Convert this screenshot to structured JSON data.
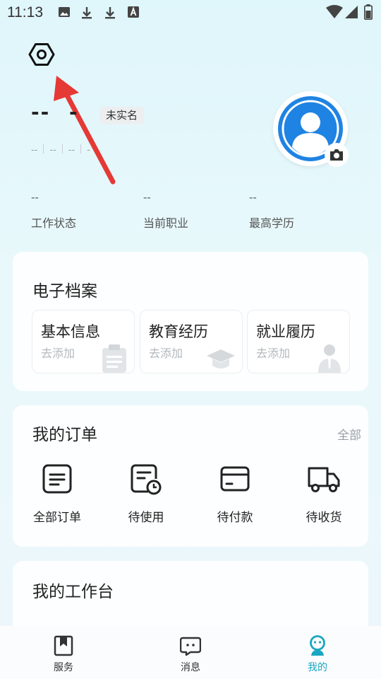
{
  "status_bar": {
    "time": "11:13"
  },
  "profile": {
    "name": "--",
    "name_extra": "-",
    "verify_badge": "未实名",
    "meta": [
      "--",
      "--",
      "--",
      "-"
    ]
  },
  "stats": [
    {
      "value": "--",
      "label": "工作状态"
    },
    {
      "value": "--",
      "label": "当前职业"
    },
    {
      "value": "--",
      "label": "最高学历"
    }
  ],
  "archive": {
    "title": "电子档案",
    "items": [
      {
        "title": "基本信息",
        "sub": "去添加",
        "icon": "clipboard-icon"
      },
      {
        "title": "教育经历",
        "sub": "去添加",
        "icon": "graduation-cap-icon"
      },
      {
        "title": "就业履历",
        "sub": "去添加",
        "icon": "worker-icon"
      }
    ]
  },
  "orders": {
    "title": "我的订单",
    "all_label": "全部",
    "items": [
      {
        "label": "全部订单",
        "icon": "order-list-icon"
      },
      {
        "label": "待使用",
        "icon": "pending-use-icon"
      },
      {
        "label": "待付款",
        "icon": "wallet-card-icon"
      },
      {
        "label": "待收货",
        "icon": "truck-icon"
      }
    ]
  },
  "workbench": {
    "title": "我的工作台"
  },
  "tabs": [
    {
      "label": "服务",
      "icon": "bookmark-icon"
    },
    {
      "label": "消息",
      "icon": "chat-icon"
    },
    {
      "label": "我的",
      "icon": "profile-icon",
      "active": true
    }
  ],
  "colors": {
    "accent": "#1aa6c2",
    "avatar_blue": "#1f83e3",
    "arrow_red": "#e53935"
  }
}
